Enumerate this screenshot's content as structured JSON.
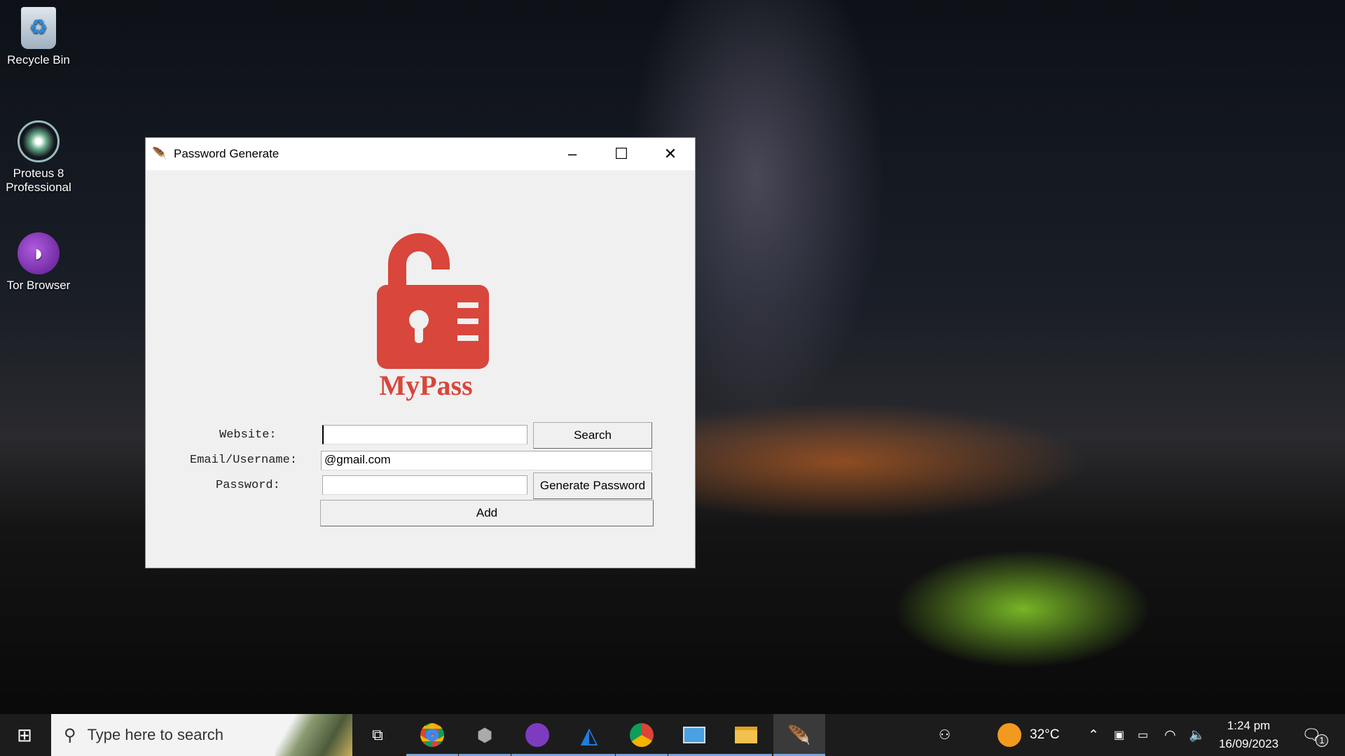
{
  "desktop": {
    "icons": [
      {
        "label": "Recycle Bin"
      },
      {
        "label": "Proteus 8 Professional"
      },
      {
        "label": "Tor Browser"
      }
    ]
  },
  "window": {
    "title": "Password Generate",
    "controls": {
      "minimize": "–",
      "maximize": "☐",
      "close": "✕"
    },
    "logo": {
      "text": "MyPass",
      "color": "#d9463b"
    },
    "form": {
      "website_label": "Website:",
      "website_value": "",
      "search_label": "Search",
      "email_label": "Email/Username:",
      "email_value": "@gmail.com",
      "password_label": "Password:",
      "password_value": "",
      "generate_label": "Generate Password",
      "add_label": "Add"
    }
  },
  "taskbar": {
    "search_placeholder": "Type here to search",
    "apps": [
      "task-view",
      "chrome",
      "app",
      "tor-browser",
      "wireshark",
      "chrome",
      "control-panel",
      "file-explorer",
      "python-tk"
    ],
    "weather": "32°C",
    "time": "1:24 pm",
    "date": "16/09/2023",
    "notification_count": "1"
  }
}
